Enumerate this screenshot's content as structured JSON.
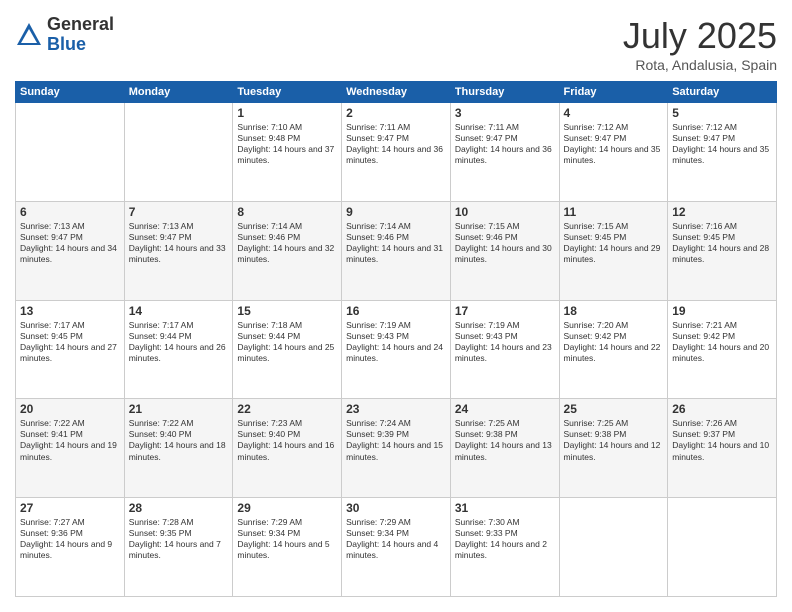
{
  "header": {
    "logo_line1": "General",
    "logo_line2": "Blue",
    "title": "July 2025",
    "location": "Rota, Andalusia, Spain"
  },
  "days_of_week": [
    "Sunday",
    "Monday",
    "Tuesday",
    "Wednesday",
    "Thursday",
    "Friday",
    "Saturday"
  ],
  "weeks": [
    [
      {
        "day": "",
        "content": ""
      },
      {
        "day": "",
        "content": ""
      },
      {
        "day": "1",
        "content": "Sunrise: 7:10 AM\nSunset: 9:48 PM\nDaylight: 14 hours and 37 minutes."
      },
      {
        "day": "2",
        "content": "Sunrise: 7:11 AM\nSunset: 9:47 PM\nDaylight: 14 hours and 36 minutes."
      },
      {
        "day": "3",
        "content": "Sunrise: 7:11 AM\nSunset: 9:47 PM\nDaylight: 14 hours and 36 minutes."
      },
      {
        "day": "4",
        "content": "Sunrise: 7:12 AM\nSunset: 9:47 PM\nDaylight: 14 hours and 35 minutes."
      },
      {
        "day": "5",
        "content": "Sunrise: 7:12 AM\nSunset: 9:47 PM\nDaylight: 14 hours and 35 minutes."
      }
    ],
    [
      {
        "day": "6",
        "content": "Sunrise: 7:13 AM\nSunset: 9:47 PM\nDaylight: 14 hours and 34 minutes."
      },
      {
        "day": "7",
        "content": "Sunrise: 7:13 AM\nSunset: 9:47 PM\nDaylight: 14 hours and 33 minutes."
      },
      {
        "day": "8",
        "content": "Sunrise: 7:14 AM\nSunset: 9:46 PM\nDaylight: 14 hours and 32 minutes."
      },
      {
        "day": "9",
        "content": "Sunrise: 7:14 AM\nSunset: 9:46 PM\nDaylight: 14 hours and 31 minutes."
      },
      {
        "day": "10",
        "content": "Sunrise: 7:15 AM\nSunset: 9:46 PM\nDaylight: 14 hours and 30 minutes."
      },
      {
        "day": "11",
        "content": "Sunrise: 7:15 AM\nSunset: 9:45 PM\nDaylight: 14 hours and 29 minutes."
      },
      {
        "day": "12",
        "content": "Sunrise: 7:16 AM\nSunset: 9:45 PM\nDaylight: 14 hours and 28 minutes."
      }
    ],
    [
      {
        "day": "13",
        "content": "Sunrise: 7:17 AM\nSunset: 9:45 PM\nDaylight: 14 hours and 27 minutes."
      },
      {
        "day": "14",
        "content": "Sunrise: 7:17 AM\nSunset: 9:44 PM\nDaylight: 14 hours and 26 minutes."
      },
      {
        "day": "15",
        "content": "Sunrise: 7:18 AM\nSunset: 9:44 PM\nDaylight: 14 hours and 25 minutes."
      },
      {
        "day": "16",
        "content": "Sunrise: 7:19 AM\nSunset: 9:43 PM\nDaylight: 14 hours and 24 minutes."
      },
      {
        "day": "17",
        "content": "Sunrise: 7:19 AM\nSunset: 9:43 PM\nDaylight: 14 hours and 23 minutes."
      },
      {
        "day": "18",
        "content": "Sunrise: 7:20 AM\nSunset: 9:42 PM\nDaylight: 14 hours and 22 minutes."
      },
      {
        "day": "19",
        "content": "Sunrise: 7:21 AM\nSunset: 9:42 PM\nDaylight: 14 hours and 20 minutes."
      }
    ],
    [
      {
        "day": "20",
        "content": "Sunrise: 7:22 AM\nSunset: 9:41 PM\nDaylight: 14 hours and 19 minutes."
      },
      {
        "day": "21",
        "content": "Sunrise: 7:22 AM\nSunset: 9:40 PM\nDaylight: 14 hours and 18 minutes."
      },
      {
        "day": "22",
        "content": "Sunrise: 7:23 AM\nSunset: 9:40 PM\nDaylight: 14 hours and 16 minutes."
      },
      {
        "day": "23",
        "content": "Sunrise: 7:24 AM\nSunset: 9:39 PM\nDaylight: 14 hours and 15 minutes."
      },
      {
        "day": "24",
        "content": "Sunrise: 7:25 AM\nSunset: 9:38 PM\nDaylight: 14 hours and 13 minutes."
      },
      {
        "day": "25",
        "content": "Sunrise: 7:25 AM\nSunset: 9:38 PM\nDaylight: 14 hours and 12 minutes."
      },
      {
        "day": "26",
        "content": "Sunrise: 7:26 AM\nSunset: 9:37 PM\nDaylight: 14 hours and 10 minutes."
      }
    ],
    [
      {
        "day": "27",
        "content": "Sunrise: 7:27 AM\nSunset: 9:36 PM\nDaylight: 14 hours and 9 minutes."
      },
      {
        "day": "28",
        "content": "Sunrise: 7:28 AM\nSunset: 9:35 PM\nDaylight: 14 hours and 7 minutes."
      },
      {
        "day": "29",
        "content": "Sunrise: 7:29 AM\nSunset: 9:34 PM\nDaylight: 14 hours and 5 minutes."
      },
      {
        "day": "30",
        "content": "Sunrise: 7:29 AM\nSunset: 9:34 PM\nDaylight: 14 hours and 4 minutes."
      },
      {
        "day": "31",
        "content": "Sunrise: 7:30 AM\nSunset: 9:33 PM\nDaylight: 14 hours and 2 minutes."
      },
      {
        "day": "",
        "content": ""
      },
      {
        "day": "",
        "content": ""
      }
    ]
  ]
}
